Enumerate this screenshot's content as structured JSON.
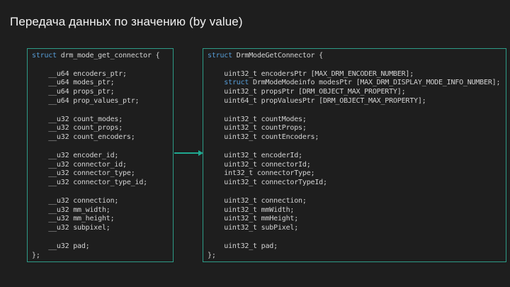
{
  "slide": {
    "title": "Передача данных по значению (by value)"
  },
  "colors": {
    "background": "#1e1e1e",
    "box_border": "#2d9b87",
    "arrow": "#1fa890",
    "keyword": "#569cd6",
    "code_text": "#d4d4d4",
    "title_text": "#f2f2f2"
  },
  "arrow": {
    "direction": "right"
  },
  "left_code_block": {
    "lines": [
      [
        {
          "text": "struct",
          "type": "keyword"
        },
        {
          "text": " drm_mode_get_connector {",
          "type": "plain"
        }
      ],
      [],
      [
        {
          "text": "    __u64 encoders_ptr;",
          "type": "plain"
        }
      ],
      [
        {
          "text": "    __u64 modes_ptr;",
          "type": "plain"
        }
      ],
      [
        {
          "text": "    __u64 props_ptr;",
          "type": "plain"
        }
      ],
      [
        {
          "text": "    __u64 prop_values_ptr;",
          "type": "plain"
        }
      ],
      [],
      [
        {
          "text": "    __u32 count_modes;",
          "type": "plain"
        }
      ],
      [
        {
          "text": "    __u32 count_props;",
          "type": "plain"
        }
      ],
      [
        {
          "text": "    __u32 count_encoders;",
          "type": "plain"
        }
      ],
      [],
      [
        {
          "text": "    __u32 encoder_id;",
          "type": "plain"
        }
      ],
      [
        {
          "text": "    __u32 connector_id;",
          "type": "plain"
        }
      ],
      [
        {
          "text": "    __u32 connector_type;",
          "type": "plain"
        }
      ],
      [
        {
          "text": "    __u32 connector_type_id;",
          "type": "plain"
        }
      ],
      [],
      [
        {
          "text": "    __u32 connection;",
          "type": "plain"
        }
      ],
      [
        {
          "text": "    __u32 mm_width;",
          "type": "plain"
        }
      ],
      [
        {
          "text": "    __u32 mm_height;",
          "type": "plain"
        }
      ],
      [
        {
          "text": "    __u32 subpixel;",
          "type": "plain"
        }
      ],
      [],
      [
        {
          "text": "    __u32 pad;",
          "type": "plain"
        }
      ],
      [
        {
          "text": "};",
          "type": "plain"
        }
      ]
    ]
  },
  "right_code_block": {
    "lines": [
      [
        {
          "text": "struct",
          "type": "keyword"
        },
        {
          "text": " DrmModeGetConnector {",
          "type": "plain"
        }
      ],
      [],
      [
        {
          "text": "    uint32_t encodersPtr [MAX_DRM_ENCODER_NUMBER];",
          "type": "plain"
        }
      ],
      [
        {
          "text": "    ",
          "type": "plain"
        },
        {
          "text": "struct",
          "type": "keyword"
        },
        {
          "text": " DrmModeModeinfo modesPtr [MAX_DRM_DISPLAY_MODE_INFO_NUMBER];",
          "type": "plain"
        }
      ],
      [
        {
          "text": "    uint32_t propsPtr [DRM_OBJECT_MAX_PROPERTY];",
          "type": "plain"
        }
      ],
      [
        {
          "text": "    uint64_t propValuesPtr [DRM_OBJECT_MAX_PROPERTY];",
          "type": "plain"
        }
      ],
      [],
      [
        {
          "text": "    uint32_t countModes;",
          "type": "plain"
        }
      ],
      [
        {
          "text": "    uint32_t countProps;",
          "type": "plain"
        }
      ],
      [
        {
          "text": "    uint32_t countEncoders;",
          "type": "plain"
        }
      ],
      [],
      [
        {
          "text": "    uint32_t encoderId;",
          "type": "plain"
        }
      ],
      [
        {
          "text": "    uint32_t connectorId;",
          "type": "plain"
        }
      ],
      [
        {
          "text": "    int32_t connectorType;",
          "type": "plain"
        }
      ],
      [
        {
          "text": "    uint32_t connectorTypeId;",
          "type": "plain"
        }
      ],
      [],
      [
        {
          "text": "    uint32_t connection;",
          "type": "plain"
        }
      ],
      [
        {
          "text": "    uint32_t mmWidth;",
          "type": "plain"
        }
      ],
      [
        {
          "text": "    uint32_t mmHeight;",
          "type": "plain"
        }
      ],
      [
        {
          "text": "    uint32_t subPixel;",
          "type": "plain"
        }
      ],
      [],
      [
        {
          "text": "    uint32_t pad;",
          "type": "plain"
        }
      ],
      [
        {
          "text": "};",
          "type": "plain"
        }
      ]
    ]
  }
}
